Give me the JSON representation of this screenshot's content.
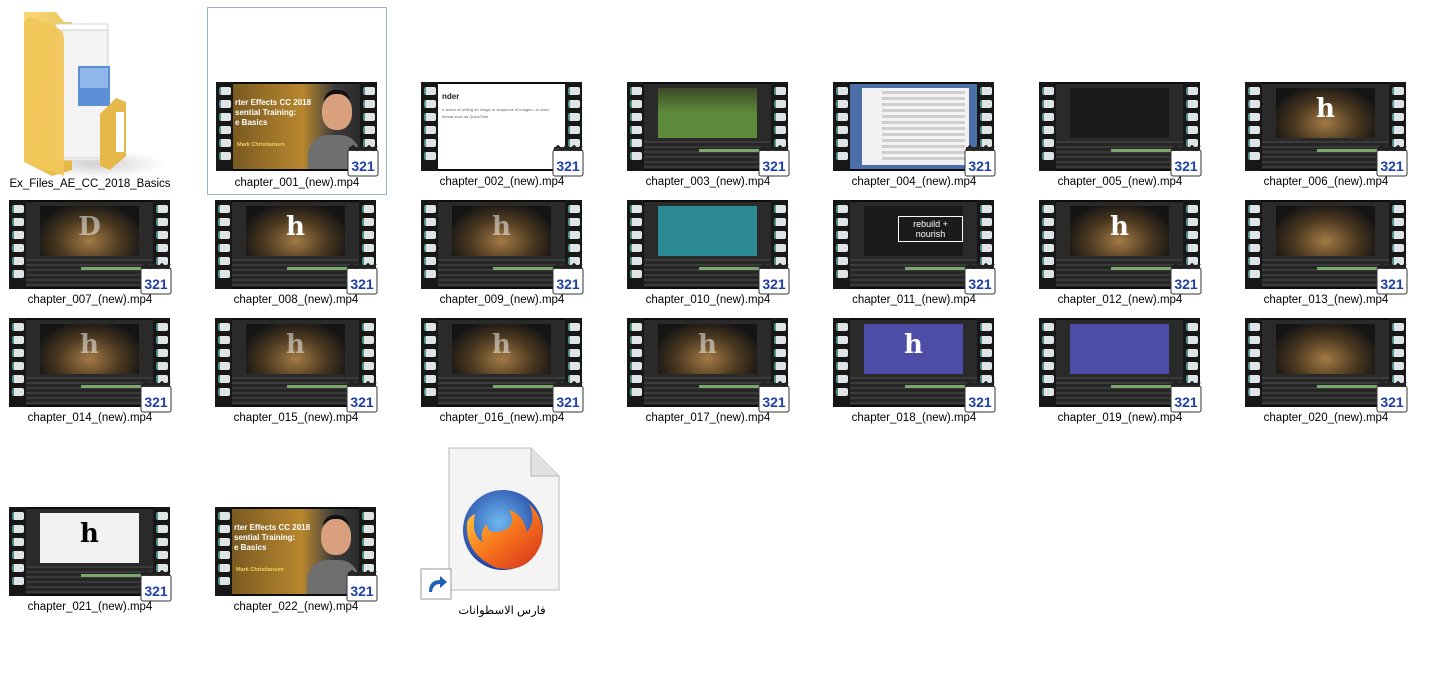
{
  "folder": {
    "label": "Ex_Files_AE_CC_2018_Basics",
    "icon": "folder-icon"
  },
  "videos": [
    {
      "label": "chapter_001_(new).mp4",
      "thumb": "title",
      "selected": true
    },
    {
      "label": "chapter_002_(new).mp4",
      "thumb": "doc"
    },
    {
      "label": "chapter_003_(new).mp4",
      "thumb": "grass"
    },
    {
      "label": "chapter_004_(new).mp4",
      "thumb": "finder"
    },
    {
      "label": "chapter_005_(new).mp4",
      "thumb": "dark"
    },
    {
      "label": "chapter_006_(new).mp4",
      "thumb": "night-h"
    },
    {
      "label": "chapter_007_(new).mp4",
      "thumb": "night-d"
    },
    {
      "label": "chapter_008_(new).mp4",
      "thumb": "night-h"
    },
    {
      "label": "chapter_009_(new).mp4",
      "thumb": "night-hdim"
    },
    {
      "label": "chapter_010_(new).mp4",
      "thumb": "teal"
    },
    {
      "label": "chapter_011_(new).mp4",
      "thumb": "rebuild"
    },
    {
      "label": "chapter_012_(new).mp4",
      "thumb": "night-h"
    },
    {
      "label": "chapter_013_(new).mp4",
      "thumb": "night"
    },
    {
      "label": "chapter_014_(new).mp4",
      "thumb": "night-hdim"
    },
    {
      "label": "chapter_015_(new).mp4",
      "thumb": "night-hdim"
    },
    {
      "label": "chapter_016_(new).mp4",
      "thumb": "night-hdim"
    },
    {
      "label": "chapter_017_(new).mp4",
      "thumb": "night-hdim"
    },
    {
      "label": "chapter_018_(new).mp4",
      "thumb": "blue-h"
    },
    {
      "label": "chapter_019_(new).mp4",
      "thumb": "blue"
    },
    {
      "label": "chapter_020_(new).mp4",
      "thumb": "night"
    },
    {
      "label": "chapter_021_(new).mp4",
      "thumb": "white-h"
    },
    {
      "label": "chapter_022_(new).mp4",
      "thumb": "title"
    }
  ],
  "thumb_text": {
    "title_line1": "rter Effects CC 2018",
    "title_line2": "sential Training:",
    "title_line3": "e Basics",
    "author": "Mark Christiansen",
    "doc_heading": "nder",
    "doc_body": "e action of writing an image or sequence of images—a video format such as QuickTime",
    "logo": "h",
    "rebuild": "rebuild + nourish",
    "badge": "321"
  },
  "shortcut": {
    "label": "فارس الاسطوانات",
    "icon": "firefox-icon",
    "overlay": "shortcut-arrow-icon"
  }
}
